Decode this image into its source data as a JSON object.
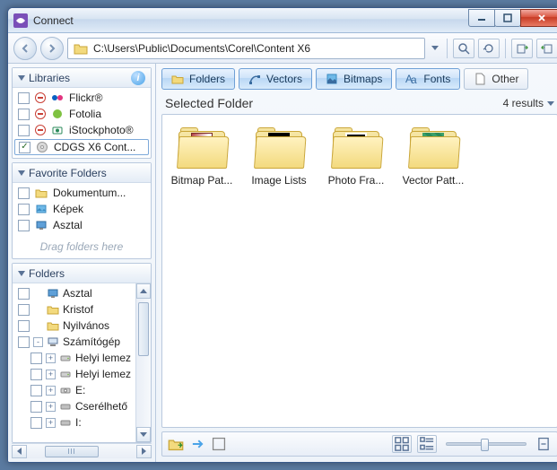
{
  "window": {
    "title": "Connect"
  },
  "address": {
    "path": "C:\\Users\\Public\\Documents\\Corel\\Content X6"
  },
  "sidebar": {
    "libraries": {
      "header": "Libraries",
      "items": [
        {
          "label": "Flickr®"
        },
        {
          "label": "Fotolia"
        },
        {
          "label": "iStockphoto®"
        },
        {
          "label": "CDGS X6 Cont..."
        }
      ]
    },
    "favorites": {
      "header": "Favorite Folders",
      "items": [
        {
          "label": "Dokumentum..."
        },
        {
          "label": "Képek"
        },
        {
          "label": "Asztal"
        }
      ],
      "hint": "Drag folders here"
    },
    "folders": {
      "header": "Folders",
      "items": [
        {
          "label": "Asztal",
          "indent": 0,
          "exp": ""
        },
        {
          "label": "Kristof",
          "indent": 0,
          "exp": ""
        },
        {
          "label": "Nyilvános",
          "indent": 0,
          "exp": ""
        },
        {
          "label": "Számítógép",
          "indent": 0,
          "exp": "-"
        },
        {
          "label": "Helyi lemez",
          "indent": 1,
          "exp": "+"
        },
        {
          "label": "Helyi lemez",
          "indent": 1,
          "exp": "+"
        },
        {
          "label": "E:",
          "indent": 1,
          "exp": "+"
        },
        {
          "label": "Cserélhető",
          "indent": 1,
          "exp": "+"
        },
        {
          "label": "I:",
          "indent": 1,
          "exp": "+"
        }
      ]
    }
  },
  "filters": {
    "folders": "Folders",
    "vectors": "Vectors",
    "bitmaps": "Bitmaps",
    "fonts": "Fonts",
    "other": "Other"
  },
  "list": {
    "header": "Selected Folder",
    "results": "4 results",
    "items": [
      {
        "label": "Bitmap Pat..."
      },
      {
        "label": "Image Lists"
      },
      {
        "label": "Photo Fra..."
      },
      {
        "label": "Vector Patt..."
      }
    ]
  }
}
